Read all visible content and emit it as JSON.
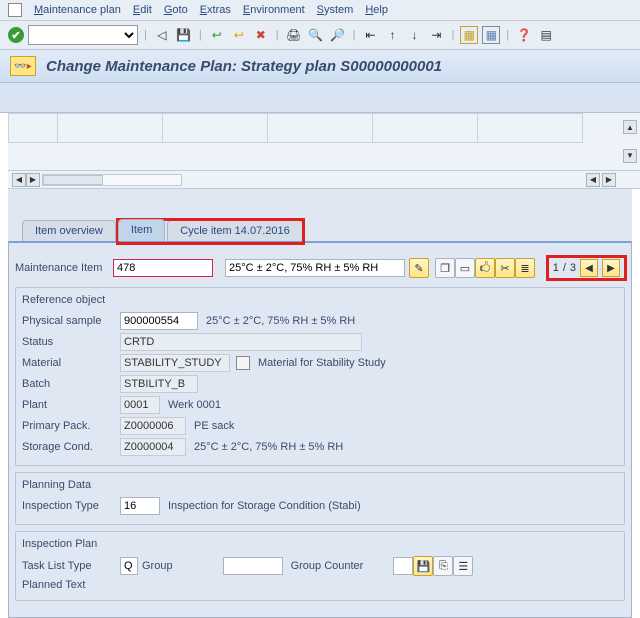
{
  "menu": {
    "items": [
      "Maintenance plan",
      "Edit",
      "Goto",
      "Extras",
      "Environment",
      "System",
      "Help"
    ]
  },
  "title": "Change Maintenance Plan: Strategy plan S00000000001",
  "tabs": {
    "items": [
      "Item overview",
      "Item",
      "Cycle item 14.07.2016"
    ],
    "activeIndex": 1
  },
  "maintItem": {
    "label": "Maintenance Item",
    "id": "478",
    "desc": "25°C ± 2°C, 75% RH ± 5% RH"
  },
  "pager": {
    "current": "1",
    "sep": "/",
    "total": "3"
  },
  "refObject": {
    "title": "Reference object",
    "physicalSample": {
      "label": "Physical sample",
      "value": "900000554",
      "desc": "25°C ± 2°C, 75% RH ± 5% RH"
    },
    "status": {
      "label": "Status",
      "value": "CRTD"
    },
    "material": {
      "label": "Material",
      "value": "STABILITY_STUDY",
      "desc": "Material for Stability Study"
    },
    "batch": {
      "label": "Batch",
      "value": "STBILITY_B"
    },
    "plant": {
      "label": "Plant",
      "value": "0001",
      "desc": "Werk 0001"
    },
    "primaryPack": {
      "label": "Primary Pack.",
      "value": "Z0000006",
      "desc": "PE sack"
    },
    "storageCond": {
      "label": "Storage Cond.",
      "value": "Z0000004",
      "desc": "25°C ± 2°C, 75% RH ± 5% RH"
    }
  },
  "planningData": {
    "title": "Planning Data",
    "inspectionType": {
      "label": "Inspection Type",
      "value": "16",
      "desc": "Inspection for Storage Condition (Stabi)"
    }
  },
  "inspectionPlan": {
    "title": "Inspection Plan",
    "taskListType": {
      "label": "Task List Type",
      "value": "Q",
      "desc": "Group",
      "counterLabel": "Group Counter"
    },
    "plannedText": {
      "label": "Planned Text"
    }
  }
}
